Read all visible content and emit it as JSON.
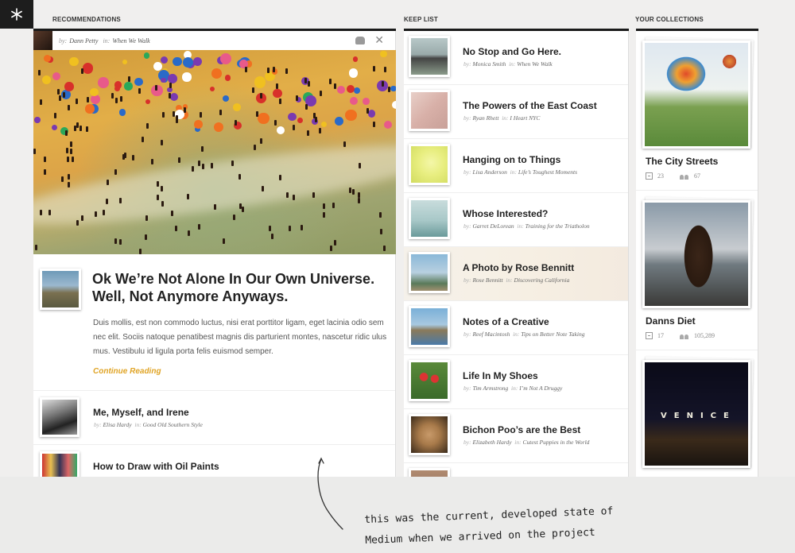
{
  "columns": {
    "recommendations_title": "RECOMMENDATIONS",
    "keep_list_title": "KEEP LIST",
    "collections_title": "YOUR COLLECTIONS"
  },
  "recommendation": {
    "by_prefix": "by:",
    "author": "Dann Petty",
    "in_prefix": "in:",
    "collection": "When We Walk",
    "close": "✕",
    "headline": "Ok We’re Not Alone In Our Own Universe. Well, Not Anymore Anyways.",
    "body": "Duis mollis, est non commodo luctus, nisi erat porttitor ligam, eget lacinia odio sem nec elit. Sociis natoque penatibest magnis dis parturient montes, nascetur ridic ulus mus. Vestibulu id ligula porta felis euismod semper.",
    "continue_label": "Continue Reading"
  },
  "rec_list": [
    {
      "title": "Me, Myself, and Irene",
      "author": "Elisa Hardy",
      "collection": "Good Old Southern Style"
    },
    {
      "title": "How to Draw with Oil Paints",
      "author": "",
      "collection": ""
    }
  ],
  "keep_list": [
    {
      "title": "No Stop and Go Here.",
      "author": "Monica Smith",
      "collection": "When We Walk"
    },
    {
      "title": "The Powers of the East Coast",
      "author": "Ryan Rhett",
      "collection": "I Heart NYC"
    },
    {
      "title": "Hanging on to Things",
      "author": "Lisa Anderson",
      "collection": "Life’s Toughest Moments"
    },
    {
      "title": "Whose Interested?",
      "author": "Garret DeLorean",
      "collection": "Training for the Triatholon"
    },
    {
      "title": "A Photo by Rose Bennitt",
      "author": "Rose Bennitt",
      "collection": "Discovering California"
    },
    {
      "title": "Notes of a Creative",
      "author": "Reef Macintosh",
      "collection": "Tips on Better Note Taking"
    },
    {
      "title": "Life In My Shoes",
      "author": "Tim Armstrong",
      "collection": "I’m Not A Druggy"
    },
    {
      "title": "Bichon Poo’s are the Best",
      "author": "Elizabeth Hardy",
      "collection": "Cutest Puppies in the World"
    }
  ],
  "collections": [
    {
      "title": "The City Streets",
      "posts": "23",
      "followers": "67"
    },
    {
      "title": "Danns Diet",
      "posts": "17",
      "followers": "105,289"
    },
    {
      "title": "",
      "posts": "",
      "followers": ""
    }
  ],
  "venice_sign": "VENICE",
  "annotation": {
    "line1": "this was the current, developed state of",
    "line2": "Medium when we arrived on the project"
  }
}
